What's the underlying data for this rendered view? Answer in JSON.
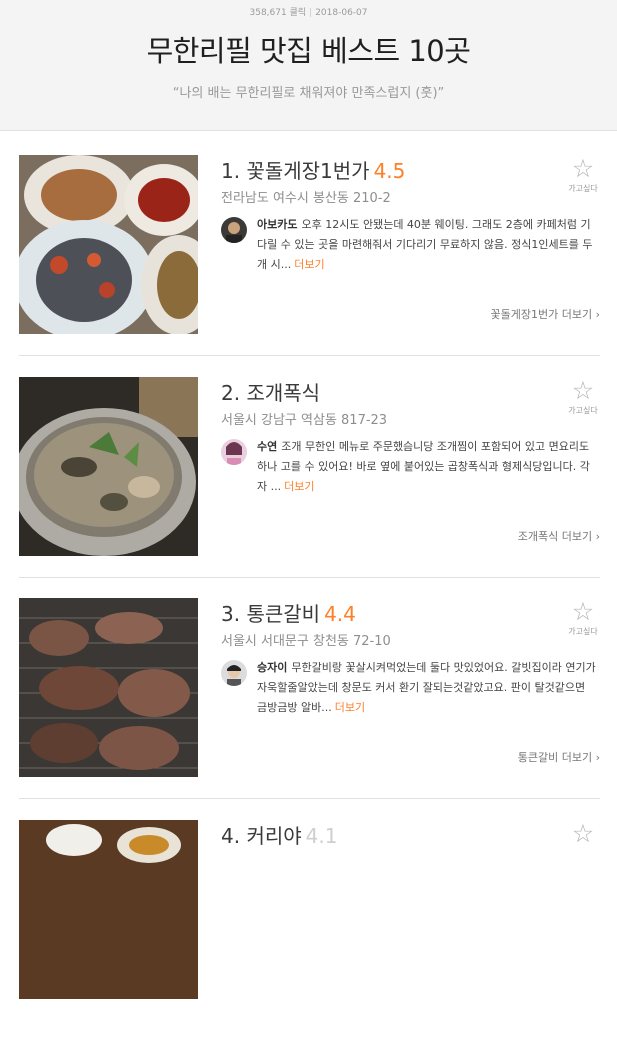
{
  "header": {
    "clicks": "358,671 클릭",
    "separator": "|",
    "date": "2018-06-07",
    "title": "무한리필 맛집 베스트 10곳",
    "subtitle": "“나의 배는 무한리필로 채워져야 만족스럽지 (훗)”"
  },
  "fav_label": "가고싶다",
  "fav_icon": "star-outline-icon",
  "review_more_label": "더보기",
  "items": [
    {
      "rank": "1.",
      "name": "꽃돌게장1번가",
      "rating": "4.5",
      "address": "전라남도 여수시 봉산동 210-2",
      "reviewer": "아보카도",
      "review": "오후 12시도 안됐는데 40분 웨이팅. 그래도 2층에 카페처럼 기다릴 수 있는 곳을 마련해줘서 기다리기 무료하지 않음. 정식1인세트를 두개 시...",
      "more_link": "꽃돌게장1번가 더보기 ›"
    },
    {
      "rank": "2.",
      "name": "조개폭식",
      "rating": "",
      "address": "서울시 강남구 역삼동 817-23",
      "reviewer": "수연",
      "review": "조개 무한인 메뉴로 주문했슴니당 조개찜이 포함되어 있고 면요리도 하나 고를 수 있어요! 바로 옆에 붙어있는 곱창폭식과 형제식당입니다. 각자 ...",
      "more_link": "조개폭식 더보기 ›"
    },
    {
      "rank": "3.",
      "name": "통큰갈비",
      "rating": "4.4",
      "address": "서울시 서대문구 창천동 72-10",
      "reviewer": "승자이",
      "review": "무한갈비랑 꽃살시켜먹었는데 둘다 맛있었어요. 갈빗집이라 연기가 자욱할줄알았는데 창문도 커서 환기 잘되는것같았고요. 판이 탈것같으면 금방금방 알바...",
      "more_link": "통큰갈비 더보기 ›"
    },
    {
      "rank": "4.",
      "name": "커리야",
      "rating": "4.1",
      "address": "",
      "reviewer": "",
      "review": "",
      "more_link": ""
    }
  ]
}
